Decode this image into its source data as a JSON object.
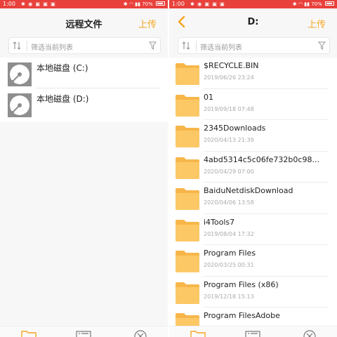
{
  "status_bar": {
    "time": "1:00",
    "battery": "70%"
  },
  "left_panel": {
    "title": "远程文件",
    "upload_label": "上传",
    "search_placeholder": "筛选当前列表",
    "drives": [
      {
        "label": "本地磁盘 (C:)"
      },
      {
        "label": "本地磁盘 (D:)"
      }
    ]
  },
  "right_panel": {
    "title": "D:",
    "upload_label": "上传",
    "search_placeholder": "筛选当前列表",
    "files": [
      {
        "name": "$RECYCLE.BIN",
        "date": "2019/06/26 23:24"
      },
      {
        "name": "01",
        "date": "2019/09/18 07:48"
      },
      {
        "name": "2345Downloads",
        "date": "2020/04/13 21:39"
      },
      {
        "name": "4abd5314c5c06fe732b0c98...",
        "date": "2020/04/29 07:00"
      },
      {
        "name": "BaiduNetdiskDownload",
        "date": "2020/04/06 13:58"
      },
      {
        "name": "i4Tools7",
        "date": "2019/08/04 17:32"
      },
      {
        "name": "Program Files",
        "date": "2020/03/25 00:31"
      },
      {
        "name": "Program Files (x86)",
        "date": "2019/12/18 15:13"
      },
      {
        "name": "Program FilesAdobe",
        "date": ""
      }
    ]
  },
  "colors": {
    "status_bar": "#e8413c",
    "accent": "#f5a623",
    "folder": "#fcc866"
  }
}
